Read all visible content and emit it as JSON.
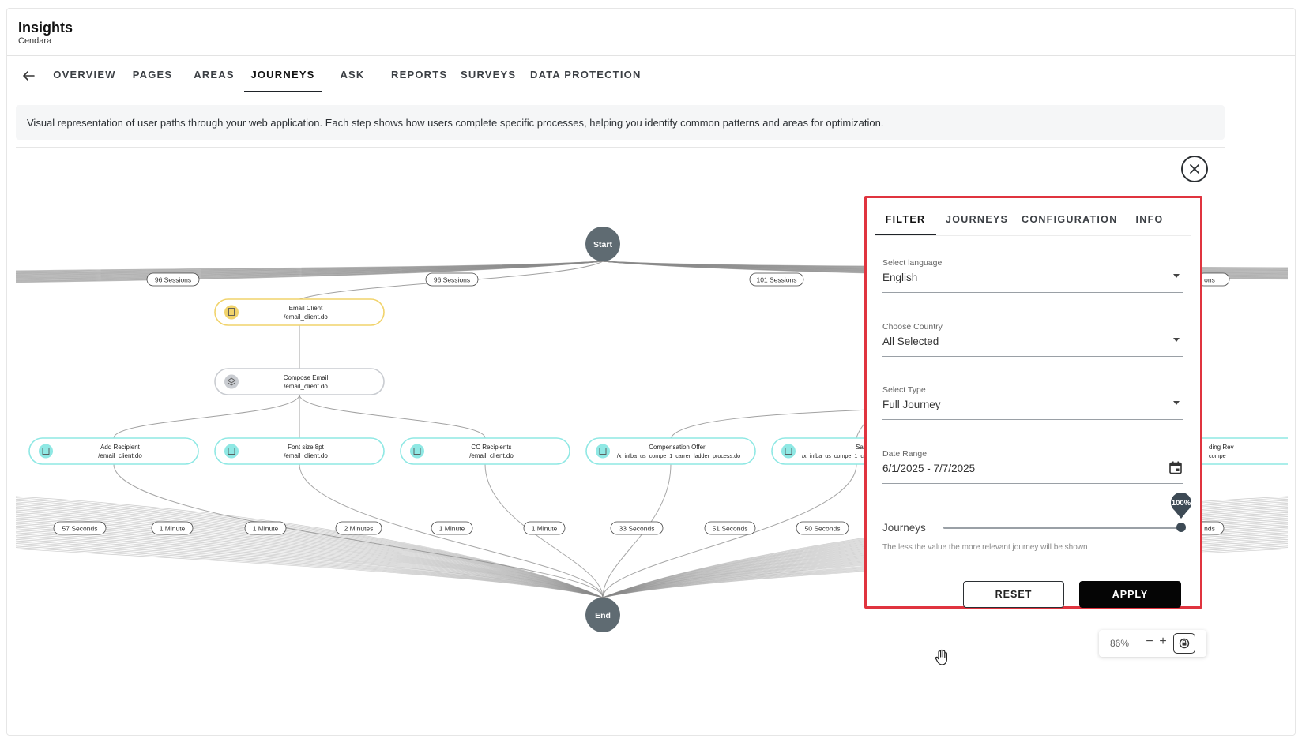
{
  "header": {
    "title": "Insights",
    "subtitle": "Cendara"
  },
  "nav": {
    "tabs": [
      "OVERVIEW",
      "PAGES",
      "AREAS",
      "JOURNEYS",
      "ASK",
      "REPORTS",
      "SURVEYS",
      "DATA PROTECTION"
    ],
    "active": "JOURNEYS"
  },
  "description": "Visual representation of user paths through your web application. Each step shows how users complete specific processes, helping you identify common patterns and areas for optimization.",
  "graph": {
    "start_label": "Start",
    "end_label": "End",
    "session_badges": [
      "96 Sessions",
      "96 Sessions",
      "101 Sessions",
      "ons"
    ],
    "nodes": [
      {
        "name": "Email Client",
        "path": "/email_client.do",
        "icon": "document-icon",
        "color": "#f1d36b"
      },
      {
        "name": "Compose Email",
        "path": "/email_client.do",
        "icon": "layers-icon",
        "color": "#c9ccd1"
      },
      {
        "name": "Add Recipient",
        "path": "/email_client.do",
        "icon": "list-icon",
        "color": "#8fe8e4"
      },
      {
        "name": "Font size 8pt",
        "path": "/email_client.do",
        "icon": "list-icon",
        "color": "#8fe8e4"
      },
      {
        "name": "CC Recipients",
        "path": "/email_client.do",
        "icon": "list-icon",
        "color": "#8fe8e4"
      },
      {
        "name": "Compensation Offer",
        "path": "/x_infba_us_compe_1_carrer_ladder_process.do",
        "icon": "list-icon",
        "color": "#8fe8e4"
      },
      {
        "name": "Sav",
        "path": "/x_infba_us_compe_1_ca",
        "icon": "list-icon",
        "color": "#8fe8e4"
      },
      {
        "name": "ding Rev",
        "path": "compe_",
        "icon": "list-icon",
        "color": "#8fe8e4"
      }
    ],
    "time_badges": [
      "57 Seconds",
      "1 Minute",
      "1 Minute",
      "2 Minutes",
      "1 Minute",
      "1 Minute",
      "33 Seconds",
      "51 Seconds",
      "50 Seconds",
      "nds"
    ]
  },
  "filter_panel": {
    "tabs": [
      "FILTER",
      "JOURNEYS",
      "CONFIGURATION",
      "INFO"
    ],
    "active_tab": "FILTER",
    "language": {
      "label": "Select language",
      "value": "English"
    },
    "country": {
      "label": "Choose Country",
      "value": "All Selected"
    },
    "type": {
      "label": "Select Type",
      "value": "Full Journey"
    },
    "date_range": {
      "label": "Date Range",
      "value": "6/1/2025 - 7/7/2025"
    },
    "journeys_slider": {
      "label": "Journeys",
      "value_text": "100%",
      "value": 1.0,
      "hint": "The less the value the more relevant journey will be shown"
    },
    "reset_label": "RESET",
    "apply_label": "APPLY",
    "highlight_color": "#e0343f"
  },
  "zoom": {
    "level": "86%",
    "minus": "−",
    "plus": "+"
  }
}
